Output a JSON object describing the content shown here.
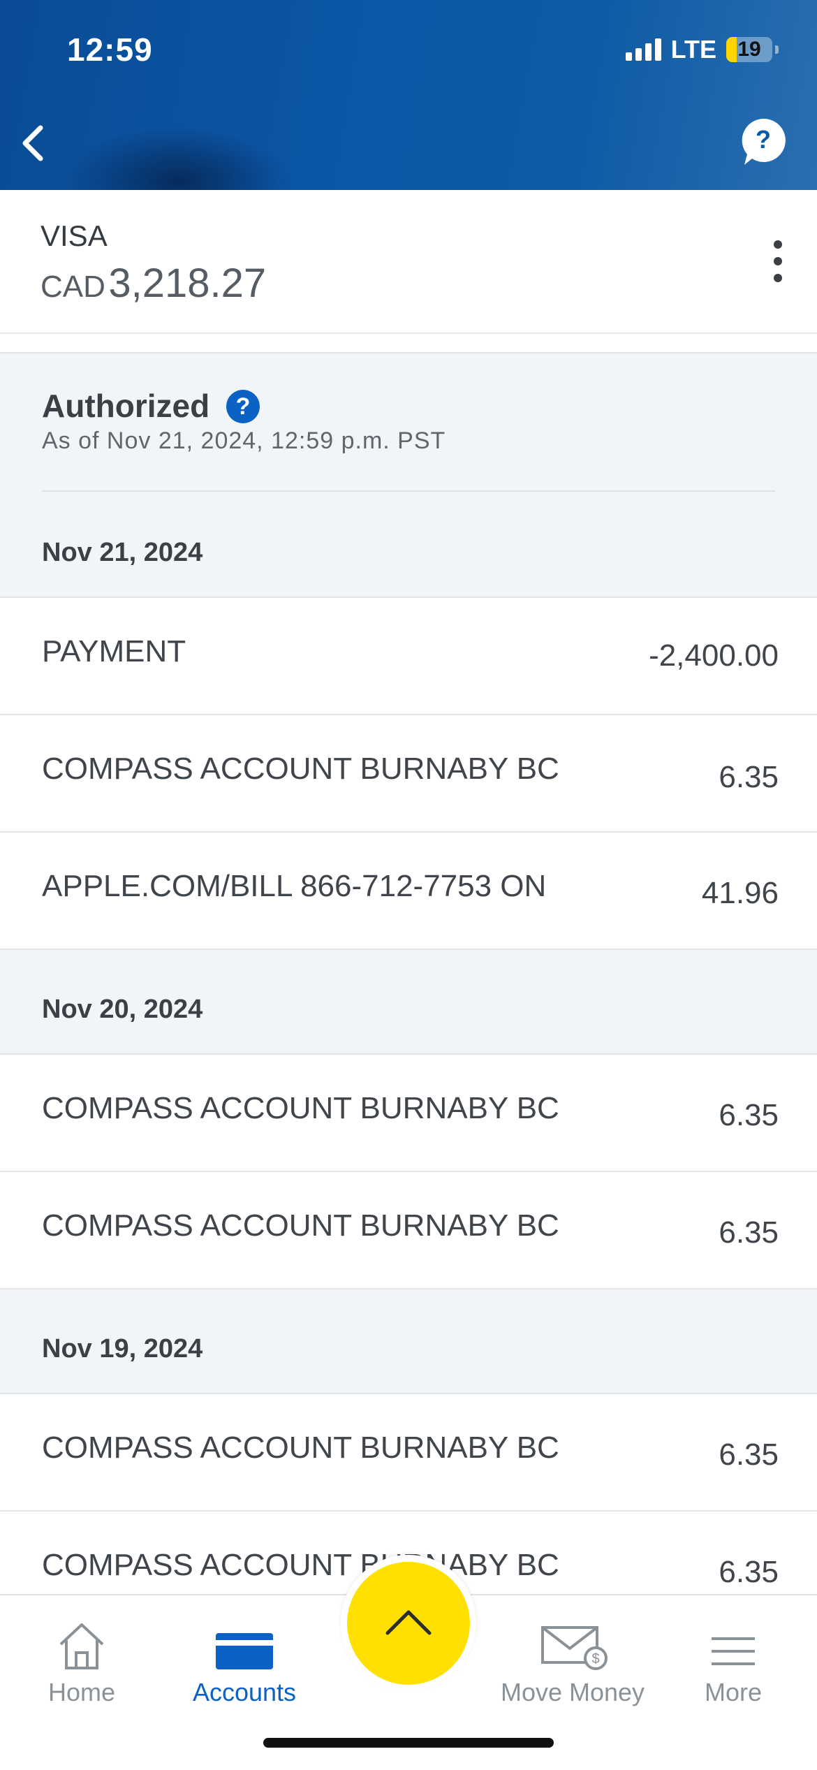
{
  "status_bar": {
    "time": "12:59",
    "network": "LTE",
    "battery": "19"
  },
  "account": {
    "name": "VISA",
    "currency": "CAD",
    "balance": "3,218.27"
  },
  "authorized": {
    "title": "Authorized",
    "help": "?",
    "as_of": "As of Nov 21, 2024, 12:59 p.m. PST"
  },
  "groups": [
    {
      "date": "Nov 21, 2024",
      "transactions": [
        {
          "description": "PAYMENT",
          "amount": "-2,400.00"
        },
        {
          "description": "COMPASS ACCOUNT BURNABY BC",
          "amount": "6.35"
        },
        {
          "description": "APPLE.COM/BILL 866-712-7753 ON",
          "amount": "41.96"
        }
      ]
    },
    {
      "date": "Nov 20, 2024",
      "transactions": [
        {
          "description": "COMPASS ACCOUNT BURNABY BC",
          "amount": "6.35"
        },
        {
          "description": "COMPASS ACCOUNT BURNABY BC",
          "amount": "6.35"
        }
      ]
    },
    {
      "date": "Nov 19, 2024",
      "transactions": [
        {
          "description": "COMPASS ACCOUNT BURNABY BC",
          "amount": "6.35"
        },
        {
          "description": "COMPASS ACCOUNT BURNABY BC",
          "amount": "6.35"
        }
      ]
    }
  ],
  "tabbar": {
    "home": "Home",
    "accounts": "Accounts",
    "move_money": "Move Money",
    "more": "More"
  },
  "colors": {
    "header": "#0b57a8",
    "accent": "#0b62c4",
    "fab": "#ffe000"
  },
  "icons": [
    "chevron-left-icon",
    "help-bubble-icon",
    "kebab-menu-icon",
    "home-icon",
    "card-icon",
    "chevron-up-icon",
    "envelope-dollar-icon",
    "menu-lines-icon"
  ]
}
